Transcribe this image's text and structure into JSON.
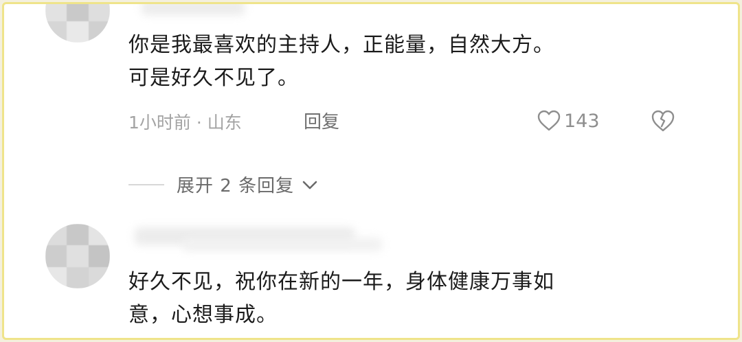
{
  "comments": [
    {
      "text_lines": [
        "你是我最喜欢的主持人，正能量，自然大方。",
        "可是好久不见了。"
      ],
      "time_location": "1小时前 · 山东",
      "reply_label": "回复",
      "like_count": "143",
      "expand_replies_label": "展开 2 条回复"
    },
    {
      "text_lines": [
        "好久不见，祝你在新的一年，身体健康万事如",
        "意，心想事成。"
      ]
    }
  ],
  "icons": {
    "like": "heart-outline-icon",
    "dislike": "broken-heart-icon",
    "expand": "chevron-down-icon"
  },
  "colors": {
    "frame_border": "#efe48a",
    "text": "#1b1b1b",
    "meta": "#a3a3a3"
  }
}
